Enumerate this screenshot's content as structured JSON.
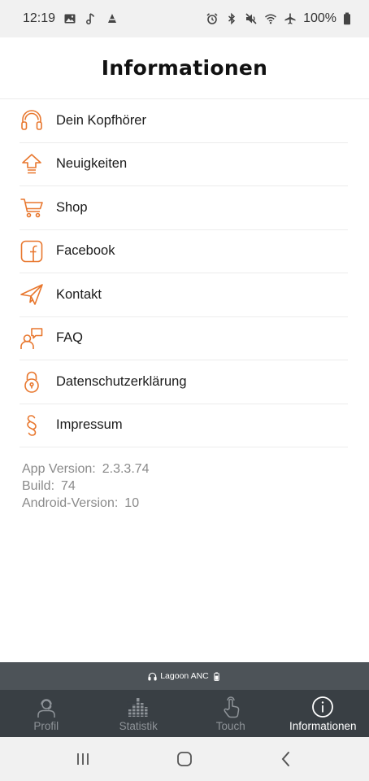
{
  "status_bar": {
    "time": "12:19",
    "battery": "100%",
    "left_icons": [
      "gallery-icon",
      "music-note-icon",
      "data-saver-icon"
    ],
    "right_icons": [
      "alarm-icon",
      "bluetooth-icon",
      "mute-icon",
      "wifi-icon",
      "airplane-icon",
      "battery-icon"
    ]
  },
  "header": {
    "title": "Informationen"
  },
  "accent_color": "#e8772e",
  "menu": {
    "items": [
      {
        "label": "Dein Kopfhörer",
        "icon": "headphones-icon"
      },
      {
        "label": "Neuigkeiten",
        "icon": "upload-arrow-icon"
      },
      {
        "label": "Shop",
        "icon": "shopping-cart-icon"
      },
      {
        "label": "Facebook",
        "icon": "facebook-icon"
      },
      {
        "label": "Kontakt",
        "icon": "paper-plane-icon"
      },
      {
        "label": "FAQ",
        "icon": "person-speech-icon"
      },
      {
        "label": "Datenschutzerklärung",
        "icon": "padlock-icon"
      },
      {
        "label": "Impressum",
        "icon": "paragraph-icon"
      }
    ]
  },
  "app_info": {
    "version_label": "App Version:",
    "version_value": "2.3.3.74",
    "build_label": "Build:",
    "build_value": "74",
    "android_label": "Android-Version:",
    "android_value": "10"
  },
  "device_bar": {
    "device_name": "Lagoon ANC"
  },
  "tab_bar": {
    "tabs": [
      {
        "label": "Profil",
        "icon": "profile-headset-icon",
        "active": false
      },
      {
        "label": "Statistik",
        "icon": "equalizer-icon",
        "active": false
      },
      {
        "label": "Touch",
        "icon": "touch-hand-icon",
        "active": false
      },
      {
        "label": "Informationen",
        "icon": "info-icon",
        "active": true
      }
    ]
  },
  "nav_bar": {
    "buttons": [
      "recent-apps-icon",
      "home-icon",
      "back-icon"
    ]
  }
}
